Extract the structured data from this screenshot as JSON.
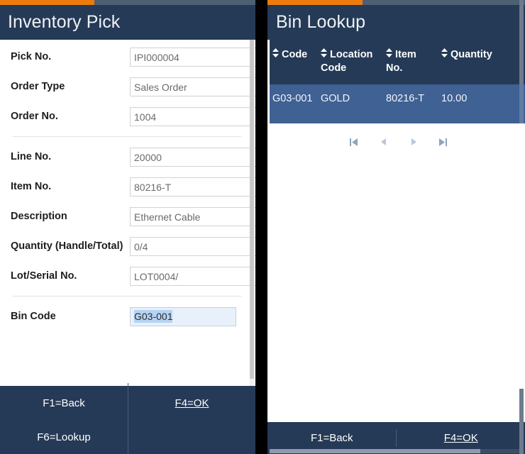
{
  "left_panel": {
    "progress_percent": 37,
    "title": "Inventory Pick",
    "fields": [
      {
        "label": "Pick No.",
        "value": "IPI000004"
      },
      {
        "label": "Order Type",
        "value": "Sales Order"
      },
      {
        "label": "Order No.",
        "value": "1004"
      },
      {
        "label": "Line No.",
        "value": "20000"
      },
      {
        "label": "Item No.",
        "value": "80216-T"
      },
      {
        "label": "Description",
        "value": "Ethernet Cable"
      },
      {
        "label": "Quantity (Handle/Total)",
        "value": "0/4"
      },
      {
        "label": "Lot/Serial No.",
        "value": "LOT0004/"
      },
      {
        "label": "Bin Code",
        "value": "G03-001"
      }
    ],
    "keybar": {
      "back": "F1=Back",
      "ok": "F4=OK",
      "lookup": "F6=Lookup"
    }
  },
  "right_panel": {
    "progress_percent": 37,
    "title": "Bin Lookup",
    "table": {
      "sort_icon": "sort-updown-icon",
      "columns": [
        "Code",
        "Location Code",
        "Item No.",
        "Quantity"
      ],
      "rows": [
        {
          "code": "G03-001",
          "location_code": "GOLD",
          "item_no": "80216-T",
          "quantity": "10.00",
          "selected": true
        }
      ]
    },
    "pager": {
      "first": "first-page-icon",
      "prev": "previous-page-icon",
      "next": "next-page-icon",
      "last": "last-page-icon"
    },
    "keybar": {
      "back": "F1=Back",
      "ok": "F4=OK"
    }
  },
  "colors": {
    "header_navy": "#253a56",
    "accent_orange": "#ee7a0c",
    "progress_track": "#4c5f73",
    "row_selected": "#3f6193",
    "focus_field_bg": "#e8f0fb",
    "selection_highlight": "#b5d3f5"
  }
}
